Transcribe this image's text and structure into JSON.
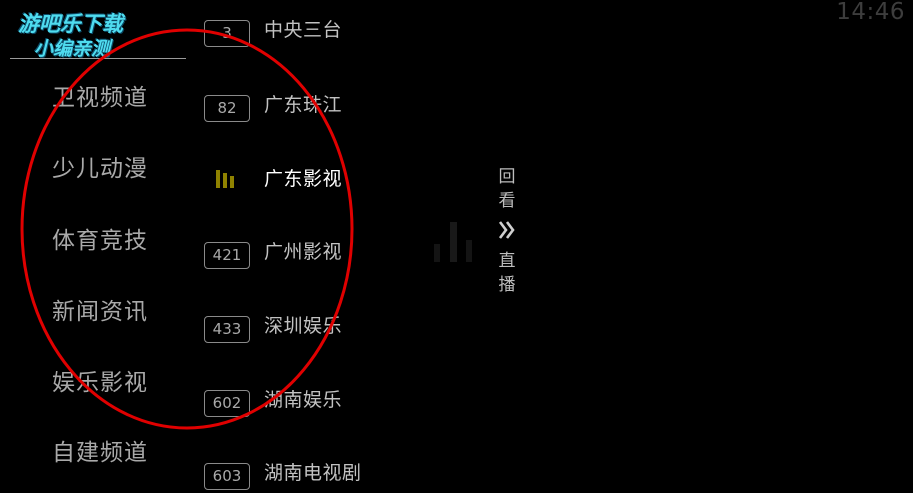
{
  "clock": "14:46",
  "watermark": {
    "line1": "游吧乐下载",
    "line2": "小编亲测"
  },
  "categories": [
    {
      "label": "卫视频道"
    },
    {
      "label": "少儿动漫"
    },
    {
      "label": "体育竞技"
    },
    {
      "label": "新闻资讯"
    },
    {
      "label": "娱乐影视"
    },
    {
      "label": "自建频道"
    }
  ],
  "channels": [
    {
      "number": "3",
      "name": "中央三台"
    },
    {
      "number": "82",
      "name": "广东珠江"
    },
    {
      "number": "",
      "name": "广东影视",
      "playing": true
    },
    {
      "number": "421",
      "name": "广州影视"
    },
    {
      "number": "433",
      "name": "深圳娱乐"
    },
    {
      "number": "602",
      "name": "湖南娱乐"
    },
    {
      "number": "603",
      "name": "湖南电视剧"
    }
  ],
  "side_action": {
    "line1": "回",
    "line2": "看",
    "line3": "直",
    "line4": "播"
  },
  "colors": {
    "annotation": "#e00000",
    "playing_indicator": "#9a8a00",
    "watermark": "#4fdcef"
  }
}
